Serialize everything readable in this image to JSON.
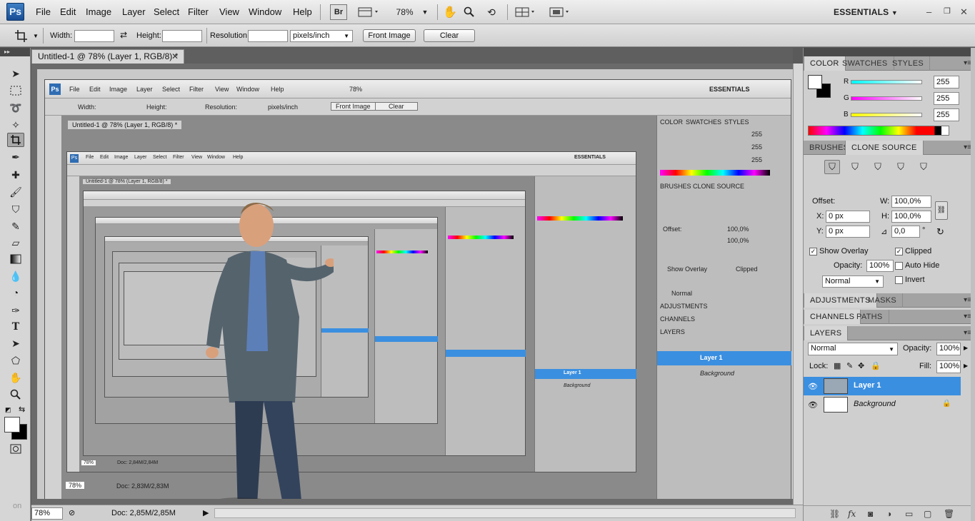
{
  "app": {
    "logo": "Ps",
    "menu": [
      "File",
      "Edit",
      "Image",
      "Layer",
      "Select",
      "Filter",
      "View",
      "Window",
      "Help"
    ],
    "bridge_label": "Br",
    "zoom": "78%",
    "workspace": "ESSENTIALS"
  },
  "options": {
    "width_label": "Width:",
    "width_value": "",
    "height_label": "Height:",
    "height_value": "",
    "resolution_label": "Resolution:",
    "resolution_value": "",
    "units": "pixels/inch",
    "front_image": "Front Image",
    "clear": "Clear"
  },
  "document": {
    "tab_title": "Untitled-1 @ 78% (Layer 1, RGB/8) *",
    "zoom": "78%",
    "doc_info": "Doc: 2,85M/2,85M",
    "nested_docs": [
      {
        "tab": "Untitled-1 @ 78% (Layer 1, RGB/8) *",
        "zoom": "78%",
        "info": "Doc: 2,83M/2,83M"
      },
      {
        "tab": "Untitled-1 @ 78% (Layer 1, RGB/8) *",
        "zoom": "78%",
        "info": "Doc: 2,84M/2,84M"
      }
    ]
  },
  "panels": {
    "color": {
      "tabs": [
        "COLOR",
        "SWATCHES",
        "STYLES"
      ],
      "channels": [
        {
          "label": "R",
          "value": "255",
          "color": "#00e5e5"
        },
        {
          "label": "G",
          "value": "255",
          "color": "#e000e0"
        },
        {
          "label": "B",
          "value": "255",
          "color": "#e6e600"
        }
      ]
    },
    "clone": {
      "tabs": [
        "BRUSHES",
        "CLONE SOURCE"
      ],
      "offset_label": "Offset:",
      "w_label": "W:",
      "w_value": "100,0%",
      "h_label": "H:",
      "h_value": "100,0%",
      "x_label": "X:",
      "x_value": "0 px",
      "y_label": "Y:",
      "y_value": "0 px",
      "angle_value": "0,0",
      "degree": "°",
      "show_overlay": "Show Overlay",
      "clipped": "Clipped",
      "opacity_label": "Opacity:",
      "opacity_value": "100%",
      "auto_hide": "Auto Hide",
      "mode": "Normal",
      "invert": "Invert"
    },
    "adjustments": {
      "tabs": [
        "ADJUSTMENTS",
        "MASKS"
      ]
    },
    "channels": {
      "tabs": [
        "CHANNELS",
        "PATHS"
      ]
    },
    "layers": {
      "tab": "LAYERS",
      "blend_mode": "Normal",
      "opacity_label": "Opacity:",
      "opacity_value": "100%",
      "lock_label": "Lock:",
      "fill_label": "Fill:",
      "fill_value": "100%",
      "items": [
        {
          "name": "Layer 1",
          "selected": true
        },
        {
          "name": "Background",
          "selected": false
        }
      ]
    }
  },
  "watermark": "on"
}
